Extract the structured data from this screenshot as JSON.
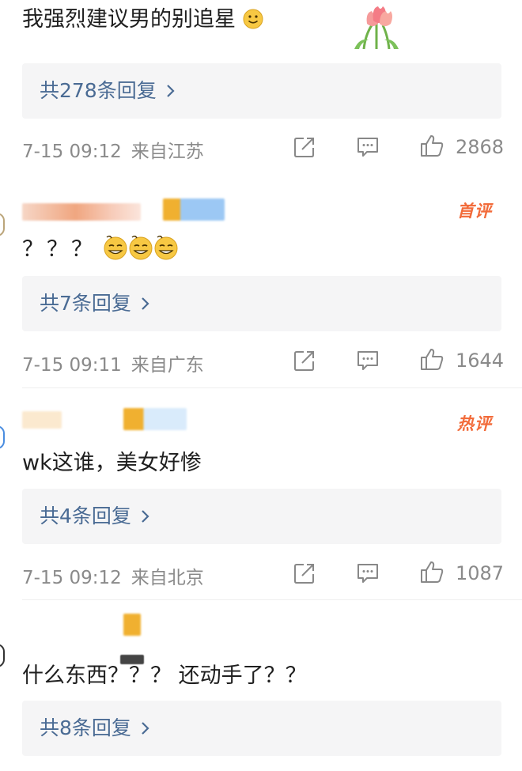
{
  "comments": [
    {
      "text": "我强烈建议男的别追星",
      "emoji": "slight-smile-emoji",
      "replies_label": "共278条回复",
      "timestamp": "7-15 09:12",
      "location": "来自江苏",
      "likes": "2868"
    },
    {
      "badge": "首评",
      "text": "？？？",
      "emoji": "sweat-smile-emoji",
      "replies_label": "共7条回复",
      "timestamp": "7-15 09:11",
      "location": "来自广东",
      "likes": "1644"
    },
    {
      "badge": "热评",
      "text": "wk这谁，美女好惨",
      "replies_label": "共4条回复",
      "timestamp": "7-15 09:12",
      "location": "来自北京",
      "likes": "1087"
    },
    {
      "text": "什么东西？？？ 还动手了？？",
      "replies_label": "共8条回复"
    }
  ],
  "icons": {
    "share": "share-icon",
    "comment": "comment-icon",
    "like": "thumbs-up-icon",
    "sticker": "tulip-sticker"
  },
  "colors": {
    "reply_link": "#4a6b94",
    "badge": "#f26b3a",
    "meta": "#8a8a8a",
    "reply_bg": "#f5f5f6"
  }
}
